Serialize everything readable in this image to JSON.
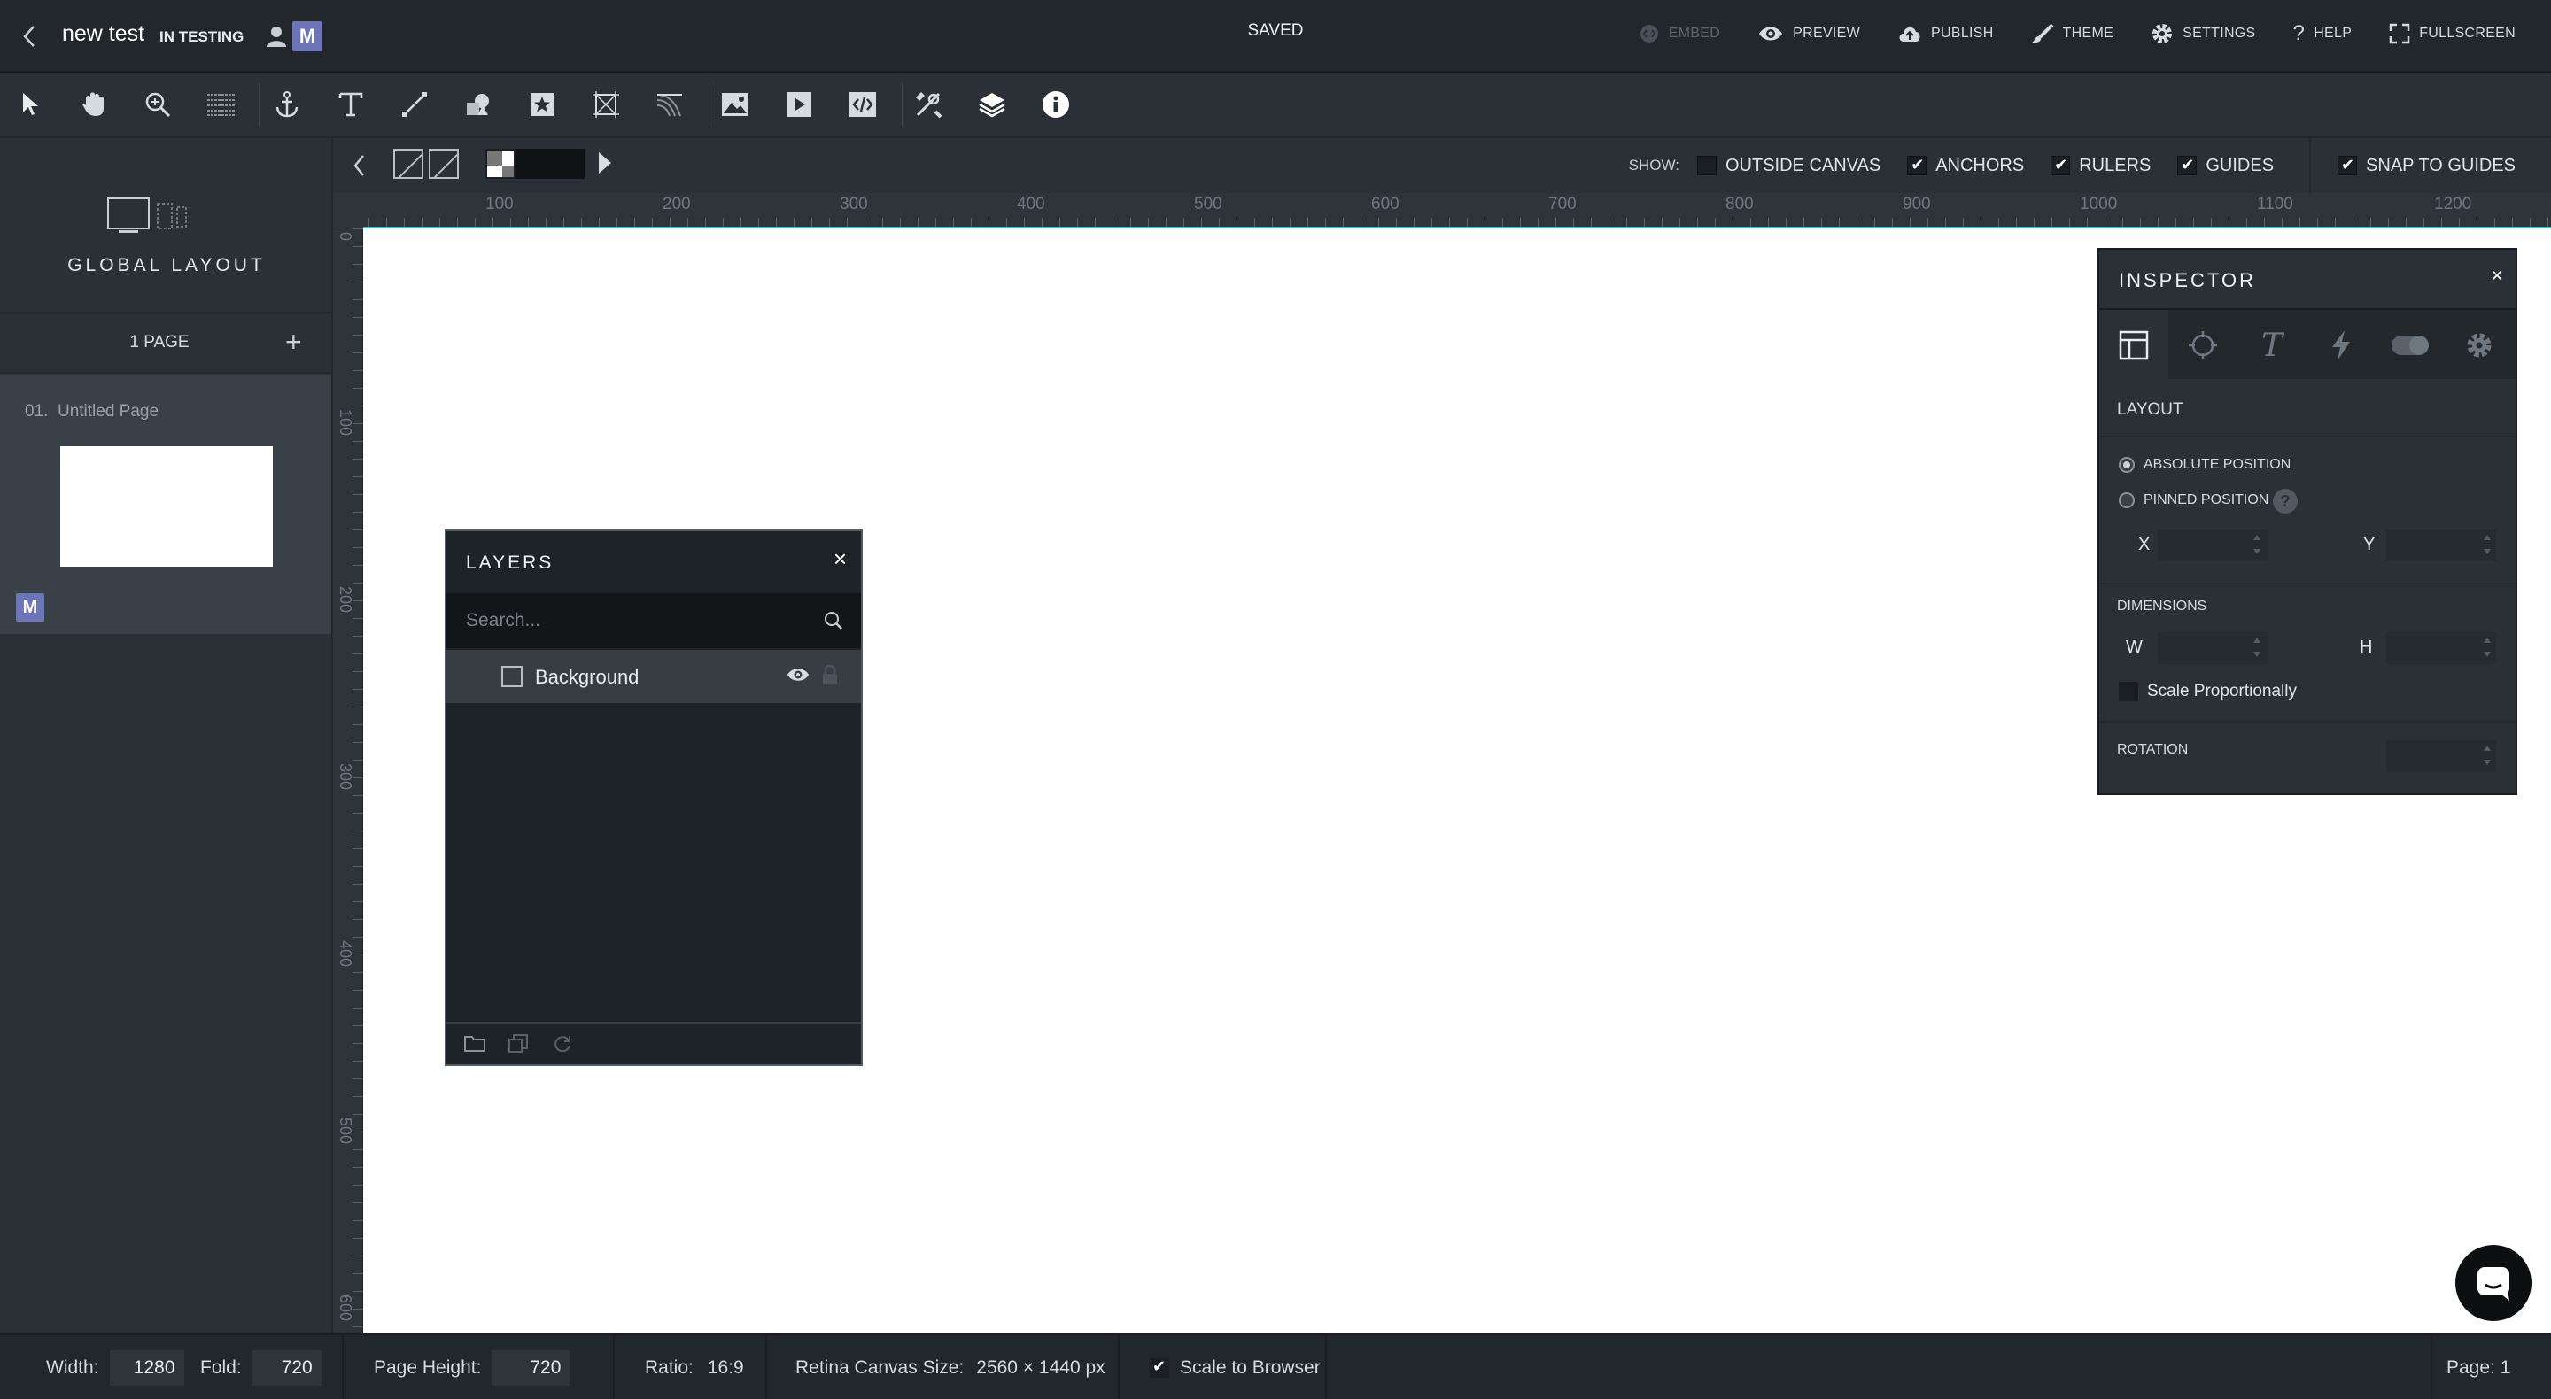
{
  "app": {
    "project_name": "new test",
    "status": "IN TESTING",
    "avatar_letter": "M",
    "save_state": "SAVED"
  },
  "topnav": [
    {
      "label": "EMBED",
      "icon": "embed-icon",
      "disabled": true
    },
    {
      "label": "PREVIEW",
      "icon": "eye-icon"
    },
    {
      "label": "PUBLISH",
      "icon": "cloud-upload-icon"
    },
    {
      "label": "THEME",
      "icon": "brush-icon"
    },
    {
      "label": "SETTINGS",
      "icon": "gear-icon"
    },
    {
      "label": "HELP",
      "icon": "question-icon"
    },
    {
      "label": "FULLSCREEN",
      "icon": "fullscreen-icon"
    }
  ],
  "toolbar": {
    "tools": [
      "select-pointer-icon",
      "hand-pan-icon",
      "zoom-icon",
      "lines-icon",
      "anchor-icon",
      "text-tool-icon",
      "line-tool-icon",
      "shapes-icon",
      "star-badge-icon",
      "crop-frame-icon",
      "gradient-icon",
      "image-icon",
      "video-play-icon",
      "embed-code-icon",
      "tools-icon",
      "layers-stack-icon",
      "info-icon"
    ]
  },
  "left_panel": {
    "title": "GLOBAL LAYOUT",
    "pages_count": "1 PAGE",
    "add_label": "+",
    "page_number": "01.",
    "page_name": "Untitled Page",
    "page_avatar": "M"
  },
  "canvas_bar": {
    "show_label": "SHOW:",
    "options": [
      {
        "label": "OUTSIDE CANVAS",
        "checked": false
      },
      {
        "label": "ANCHORS",
        "checked": true
      },
      {
        "label": "RULERS",
        "checked": true
      },
      {
        "label": "GUIDES",
        "checked": true
      }
    ],
    "snap": {
      "label": "SNAP TO GUIDES",
      "checked": true
    }
  },
  "rulers": {
    "horizontal": [
      "100",
      "200",
      "300",
      "400",
      "500",
      "600",
      "700",
      "800",
      "900",
      "1000",
      "1100",
      "1200"
    ],
    "vertical": [
      "0",
      "100",
      "200",
      "300",
      "400",
      "500",
      "600"
    ]
  },
  "layers_panel": {
    "title": "LAYERS",
    "close": "×",
    "search_placeholder": "Search...",
    "items": [
      {
        "name": "Background"
      }
    ]
  },
  "inspector": {
    "title": "INSPECTOR",
    "close": "×",
    "tabs": [
      "layout-tab-icon",
      "target-tab-icon",
      "typography-tab-icon",
      "action-bolt-icon",
      "effects-toggle-icon",
      "settings-gear-icon"
    ],
    "section": "LAYOUT",
    "absolute_position": "ABSOLUTE POSITION",
    "pinned_position": "PINNED POSITION",
    "help": "?",
    "x_label": "X",
    "y_label": "Y",
    "dimensions": "DIMENSIONS",
    "w_label": "W",
    "h_label": "H",
    "scale_proportionally": "Scale Proportionally",
    "rotation": "ROTATION"
  },
  "bottom_bar": {
    "width_label": "Width:",
    "width_value": "1280",
    "fold_label": "Fold:",
    "fold_value": "720",
    "page_height_label": "Page Height:",
    "page_height_value": "720",
    "ratio_label": "Ratio:",
    "ratio_value": "16:9",
    "retina_label": "Retina Canvas Size:",
    "retina_value": "2560 × 1440 px",
    "scale_label": "Scale to Browser",
    "page_label": "Page: 1"
  }
}
